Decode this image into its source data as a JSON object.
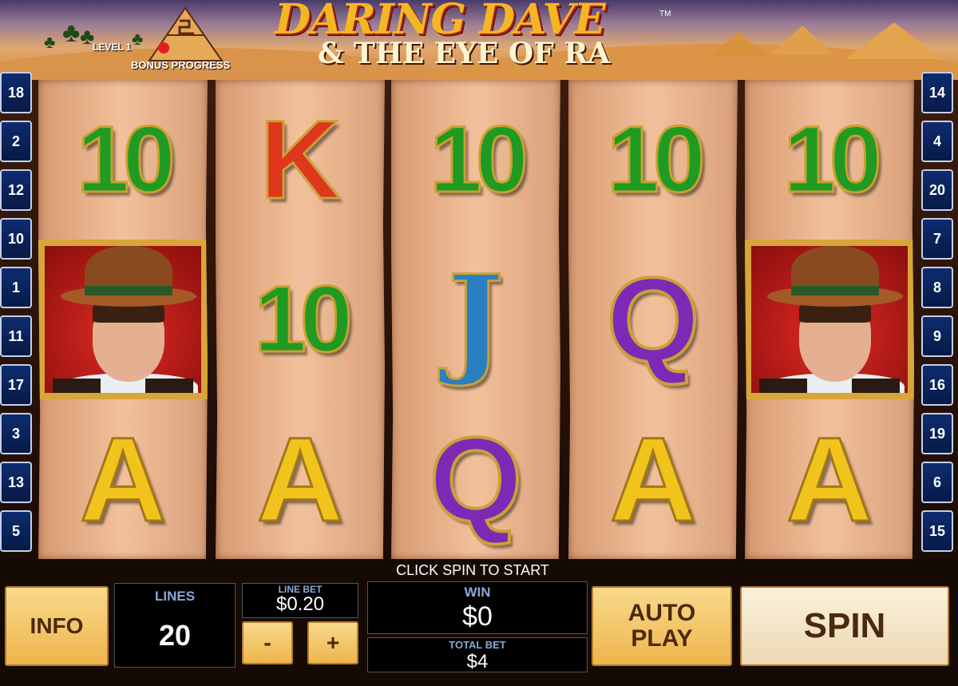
{
  "header": {
    "logo_line1": "DARING DAVE",
    "logo_line2": "& THE EYE OF RA",
    "tm": "TM",
    "level": "LEVEL 1",
    "bonus_progress": "BONUS PROGRESS"
  },
  "paylines": {
    "left": [
      "18",
      "2",
      "12",
      "10",
      "1",
      "11",
      "17",
      "3",
      "13",
      "5"
    ],
    "right": [
      "14",
      "4",
      "20",
      "7",
      "8",
      "9",
      "16",
      "19",
      "6",
      "15"
    ]
  },
  "reels": [
    [
      "10",
      "DAVE",
      "A"
    ],
    [
      "K",
      "10",
      "A"
    ],
    [
      "10",
      "J",
      "Q"
    ],
    [
      "10",
      "Q",
      "A"
    ],
    [
      "10",
      "DAVE",
      "A"
    ]
  ],
  "status": "CLICK SPIN TO START",
  "controls": {
    "info": "INFO",
    "lines_label": "LINES",
    "lines_value": "20",
    "line_bet_label": "LINE BET",
    "line_bet_value": "$0.20",
    "minus": "-",
    "plus": "+",
    "win_label": "WIN",
    "win_value": "$0",
    "total_bet_label": "TOTAL BET",
    "total_bet_value": "$4",
    "autoplay_line1": "AUTO",
    "autoplay_line2": "PLAY",
    "spin": "SPIN"
  },
  "colors": {
    "ten": "#1f9a22",
    "king": "#e0361b",
    "jack": "#2a7fc0",
    "queen": "#7e29b6",
    "ace": "#f0c41c",
    "payline_box": "#0d2c6f"
  }
}
